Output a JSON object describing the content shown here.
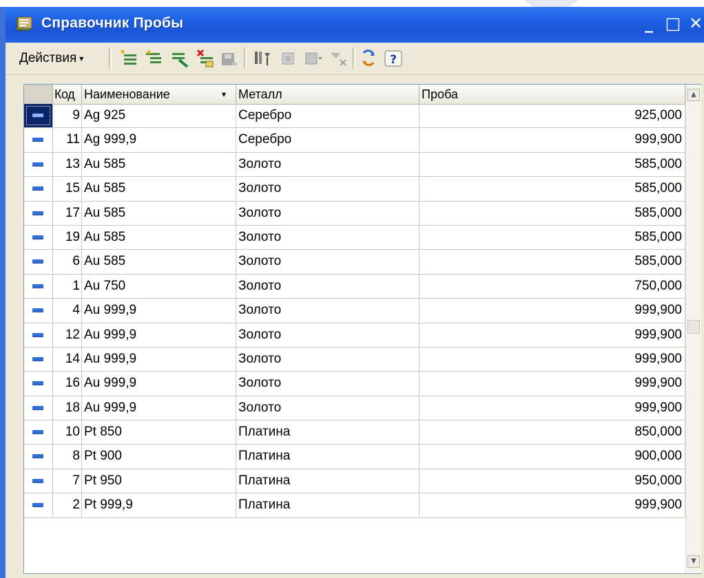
{
  "window": {
    "title": "Справочник Пробы",
    "minimize_glyph": "_",
    "maximize_glyph": "□",
    "close_glyph": "✕"
  },
  "toolbar": {
    "actions_label": "Действия",
    "actions_arrow": "▾",
    "icons": [
      "add-icon",
      "add-group-icon",
      "copy-icon",
      "edit-icon",
      "delete-mark-icon",
      "filter-icon",
      "hierarchy-icon",
      "move-icon",
      "clear-filter-icon",
      "refresh-icon",
      "help-icon"
    ]
  },
  "table": {
    "columns": {
      "code": "Код",
      "name": "Наименование",
      "name_sort": "▾",
      "metal": "Металл",
      "proba": "Проба"
    },
    "rows": [
      {
        "code": "9",
        "name": "Ag 925",
        "metal": "Серебро",
        "proba": "925,000",
        "selected": true
      },
      {
        "code": "11",
        "name": "Ag 999,9",
        "metal": "Серебро",
        "proba": "999,900"
      },
      {
        "code": "13",
        "name": "Au 585",
        "metal": "Золото",
        "proba": "585,000"
      },
      {
        "code": "15",
        "name": "Au 585",
        "metal": "Золото",
        "proba": "585,000"
      },
      {
        "code": "17",
        "name": "Au 585",
        "metal": "Золото",
        "proba": "585,000"
      },
      {
        "code": "19",
        "name": "Au 585",
        "metal": "Золото",
        "proba": "585,000"
      },
      {
        "code": "6",
        "name": "Au 585",
        "metal": "Золото",
        "proba": "585,000"
      },
      {
        "code": "1",
        "name": "Au 750",
        "metal": "Золото",
        "proba": "750,000"
      },
      {
        "code": "4",
        "name": "Au 999,9",
        "metal": "Золото",
        "proba": "999,900"
      },
      {
        "code": "12",
        "name": "Au 999,9",
        "metal": "Золото",
        "proba": "999,900"
      },
      {
        "code": "14",
        "name": "Au 999,9",
        "metal": "Золото",
        "proba": "999,900"
      },
      {
        "code": "16",
        "name": "Au 999,9",
        "metal": "Золото",
        "proba": "999,900"
      },
      {
        "code": "18",
        "name": "Au 999,9",
        "metal": "Золото",
        "proba": "999,900"
      },
      {
        "code": "10",
        "name": "Pt 850",
        "metal": "Платина",
        "proba": "850,000"
      },
      {
        "code": "8",
        "name": "Pt 900",
        "metal": "Платина",
        "proba": "900,000"
      },
      {
        "code": "7",
        "name": "Pt 950",
        "metal": "Платина",
        "proba": "950,000"
      },
      {
        "code": "2",
        "name": "Pt 999,9",
        "metal": "Платина",
        "proba": "999,900"
      }
    ]
  },
  "colors": {
    "titlebar": "#1d5fe2",
    "selection": "#0a246a",
    "row_icon": "#2f6fd8"
  }
}
